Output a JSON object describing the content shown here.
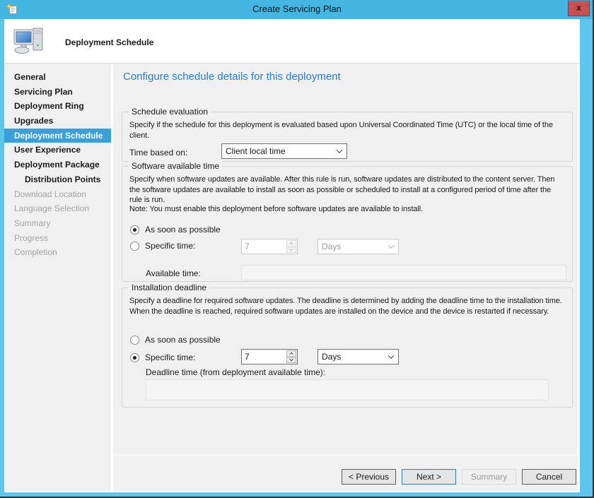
{
  "window": {
    "title": "Create Servicing Plan",
    "close_label": "x"
  },
  "header": {
    "title": "Deployment Schedule"
  },
  "sidebar": {
    "items": [
      {
        "label": "General",
        "state": "enabled"
      },
      {
        "label": "Servicing Plan",
        "state": "enabled"
      },
      {
        "label": "Deployment Ring",
        "state": "enabled"
      },
      {
        "label": "Upgrades",
        "state": "enabled"
      },
      {
        "label": "Deployment Schedule",
        "state": "selected"
      },
      {
        "label": "User Experience",
        "state": "enabled"
      },
      {
        "label": "Deployment Package",
        "state": "enabled"
      },
      {
        "label": "Distribution Points",
        "state": "enabled",
        "indent": true
      },
      {
        "label": "Download Location",
        "state": "disabled"
      },
      {
        "label": "Language Selection",
        "state": "disabled"
      },
      {
        "label": "Summary",
        "state": "disabled"
      },
      {
        "label": "Progress",
        "state": "disabled"
      },
      {
        "label": "Completion",
        "state": "disabled"
      }
    ]
  },
  "content": {
    "page_title": "Configure schedule details for this deployment",
    "schedule_evaluation": {
      "group_label": "Schedule evaluation",
      "description": "Specify if the schedule for this deployment is evaluated based upon Universal Coordinated Time (UTC) or the local time of the client.",
      "time_based_on_label": "Time based on:",
      "time_based_on_value": "Client local time"
    },
    "software_available_time": {
      "group_label": "Software available time",
      "description": "Specify when software updates are available. After this rule is run, software updates are distributed to the content server. Then the software updates are available to install as soon as possible or scheduled to install at a configured period of time after the rule is run.",
      "note": "Note: You must enable this deployment before software updates are available to install.",
      "asap_label": "As soon as possible",
      "asap_selected": true,
      "specific_label": "Specific time:",
      "specific_selected": false,
      "specific_value": "7",
      "unit_value": "Days",
      "available_time_label": "Available time:",
      "available_time_value": ""
    },
    "installation_deadline": {
      "group_label": "Installation deadline",
      "description": "Specify a deadline for required software updates. The deadline is determined by adding the deadline time to the installation time. When the deadline is reached, required software updates are installed on the device and the device is restarted if necessary.",
      "asap_label": "As soon as possible",
      "asap_selected": false,
      "specific_label": "Specific time:",
      "specific_selected": true,
      "specific_value": "7",
      "unit_value": "Days",
      "deadline_time_label": "Deadline time (from deployment available time):",
      "deadline_time_value": ""
    }
  },
  "footer": {
    "previous_label": "< Previous",
    "next_label": "Next >",
    "summary_label": "Summary",
    "cancel_label": "Cancel"
  },
  "colors": {
    "titlebar_blue": "#45b6e2",
    "frame_blue": "#5ec6ea",
    "selected_step_blue": "#3aa0dc",
    "page_title_blue": "#2b7cd3",
    "close_red": "#c75050",
    "body_gray": "#f0f0f0"
  }
}
